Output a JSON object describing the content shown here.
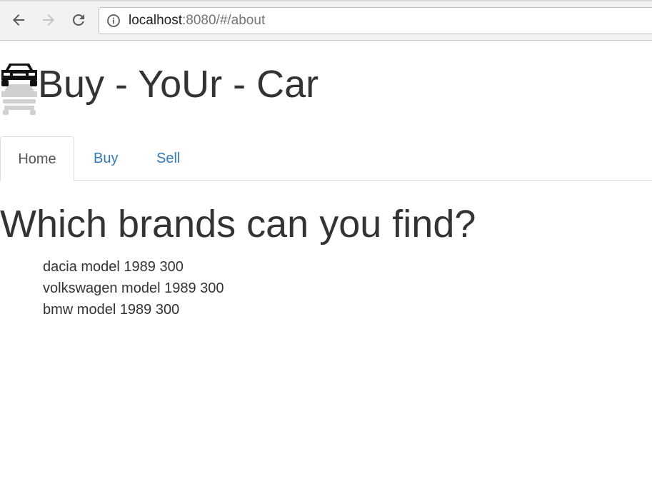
{
  "browser": {
    "url_host": "localhost",
    "url_rest": ":8080/#/about",
    "icons": [
      "back-arrow-icon",
      "forward-arrow-icon",
      "reload-icon",
      "info-icon"
    ]
  },
  "site": {
    "title": "Buy - YoUr - Car",
    "logo_icon": "car-icon"
  },
  "tabs": [
    {
      "label": "Home",
      "active": true
    },
    {
      "label": "Buy",
      "active": false
    },
    {
      "label": "Sell",
      "active": false
    }
  ],
  "main": {
    "heading": "Which brands can you find?",
    "brands": [
      "dacia model 1989 300",
      "volkswagen model 1989 300",
      "bmw model 1989 300"
    ]
  },
  "colors": {
    "link": "#337ab7",
    "text": "#333333",
    "active_tab_text": "#555555"
  }
}
